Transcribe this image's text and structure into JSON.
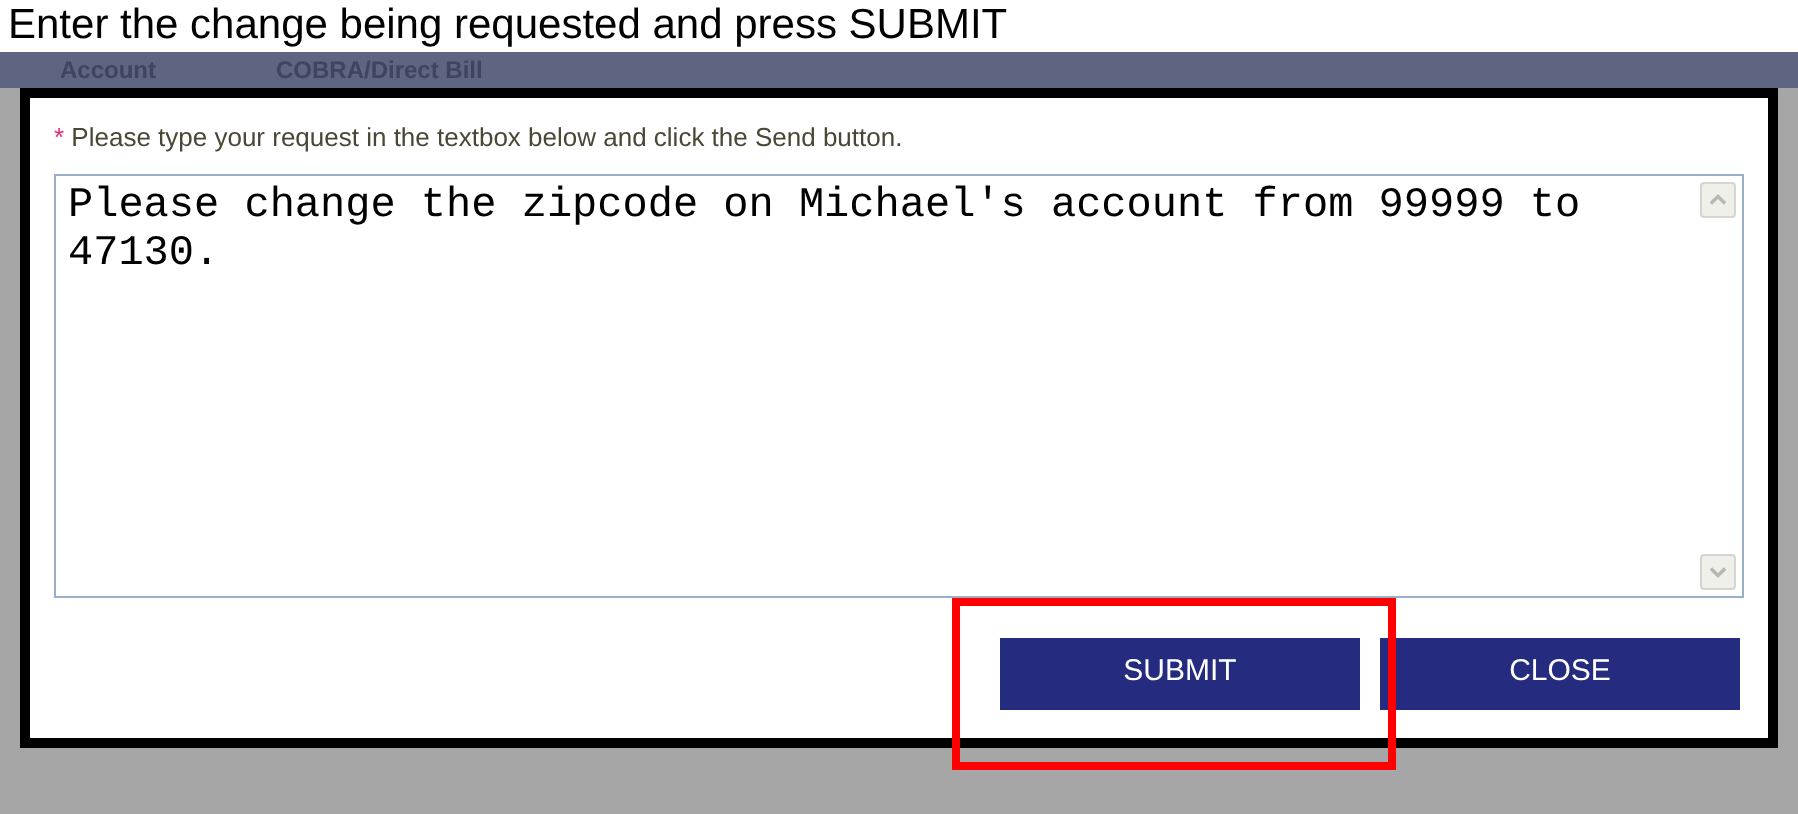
{
  "caption": "Enter the change being requested and press SUBMIT",
  "background_tabs": [
    "Account",
    "COBRA/Direct Bill"
  ],
  "dialog": {
    "required_mark": "*",
    "instruction": "Please type your request in the textbox below and click the Send button.",
    "request_text": "Please change the zipcode on Michael's account from 99999 to 47130.",
    "buttons": [
      {
        "label": "SUBMIT",
        "highlighted": true
      },
      {
        "label": "CLOSE",
        "highlighted": false
      }
    ]
  }
}
